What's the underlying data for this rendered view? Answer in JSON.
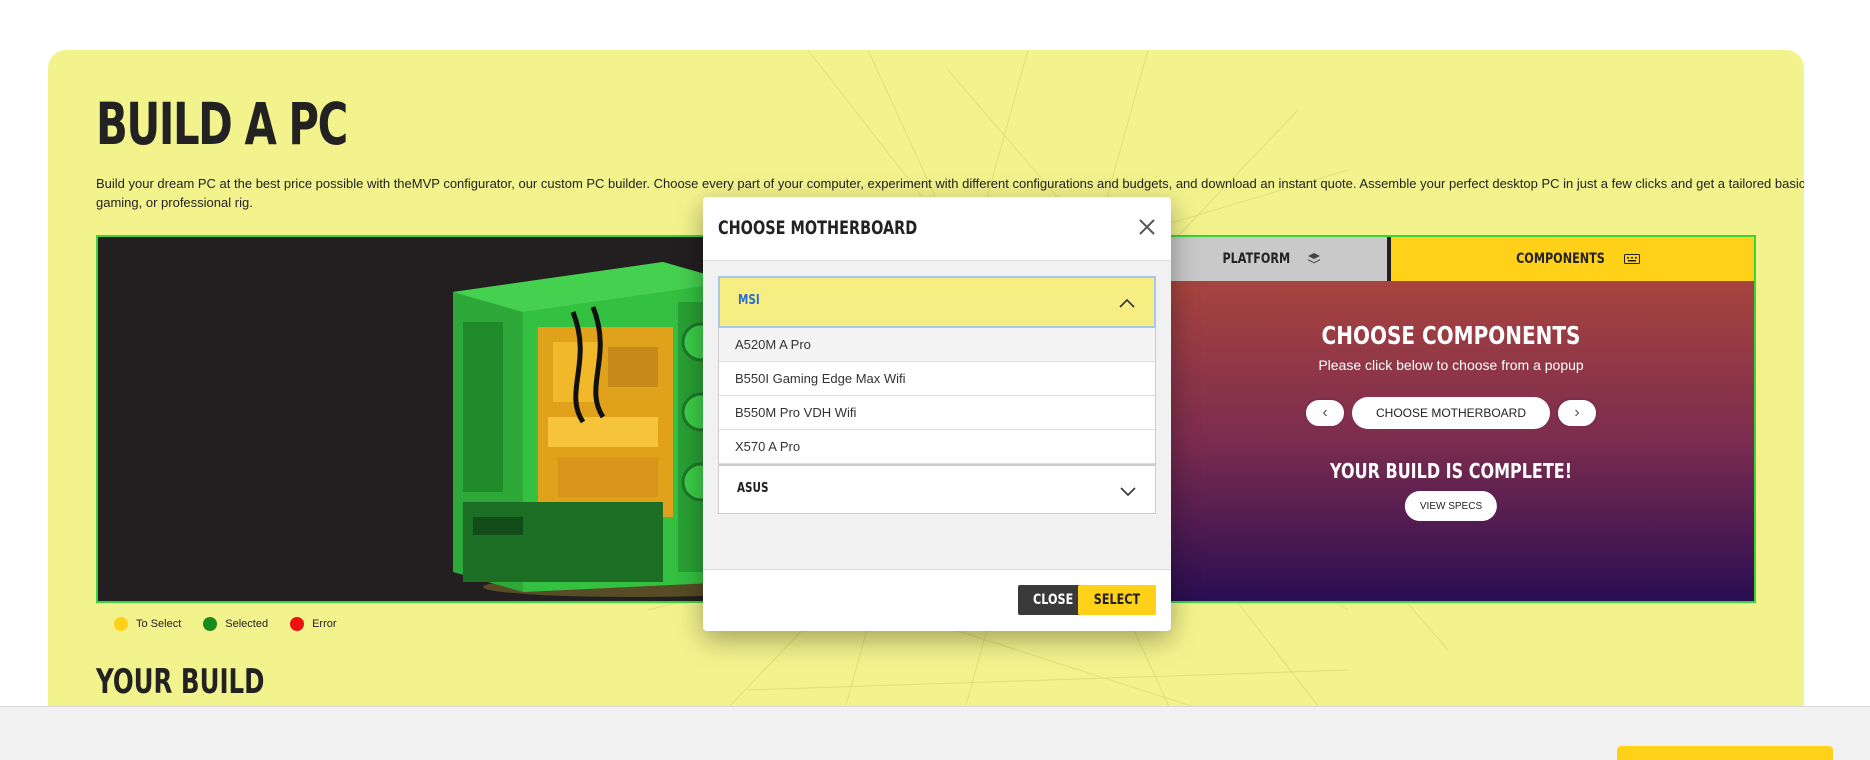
{
  "hero": {
    "title": "BUILD A PC",
    "intro": "Build your dream PC at the best price possible with theMVP configurator, our custom PC builder. Choose every part of your computer, experiment with different configurations and budgets, and download an instant quote. Assemble your perfect desktop PC in just a few clicks and get a tailored basic, gaming, or professional rig."
  },
  "tabs": {
    "platform": {
      "label": "PLATFORM",
      "icon": "layers-icon"
    },
    "components": {
      "label": "COMPONENTS",
      "icon": "keyboard-icon"
    }
  },
  "panel": {
    "heading": "CHOOSE COMPONENTS",
    "subheading": "Please click below to choose from a popup",
    "choose_button": "CHOOSE MOTHERBOARD",
    "complete_text": "YOUR BUILD IS COMPLETE!",
    "view_specs": "VIEW SPECS"
  },
  "legend": [
    {
      "label": "To Select",
      "color": "#ffd119"
    },
    {
      "label": "Selected",
      "color": "#1a8a1a"
    },
    {
      "label": "Error",
      "color": "#ee1111"
    }
  ],
  "section": {
    "your_build": "YOUR BUILD"
  },
  "modal": {
    "title": "CHOOSE MOTHERBOARD",
    "groups": [
      {
        "label": "MSI",
        "expanded": true,
        "options": [
          "A520M A Pro",
          "B550I Gaming Edge Max Wifi",
          "B550M Pro VDH Wifi",
          "X570 A Pro"
        ]
      },
      {
        "label": "ASUS",
        "expanded": false,
        "options": []
      }
    ],
    "close_label": "CLOSE",
    "select_label": "SELECT"
  },
  "colors": {
    "hero_bg": "#f3f38e",
    "accent_yellow": "#ffd119",
    "builder_border": "#39d43a"
  }
}
